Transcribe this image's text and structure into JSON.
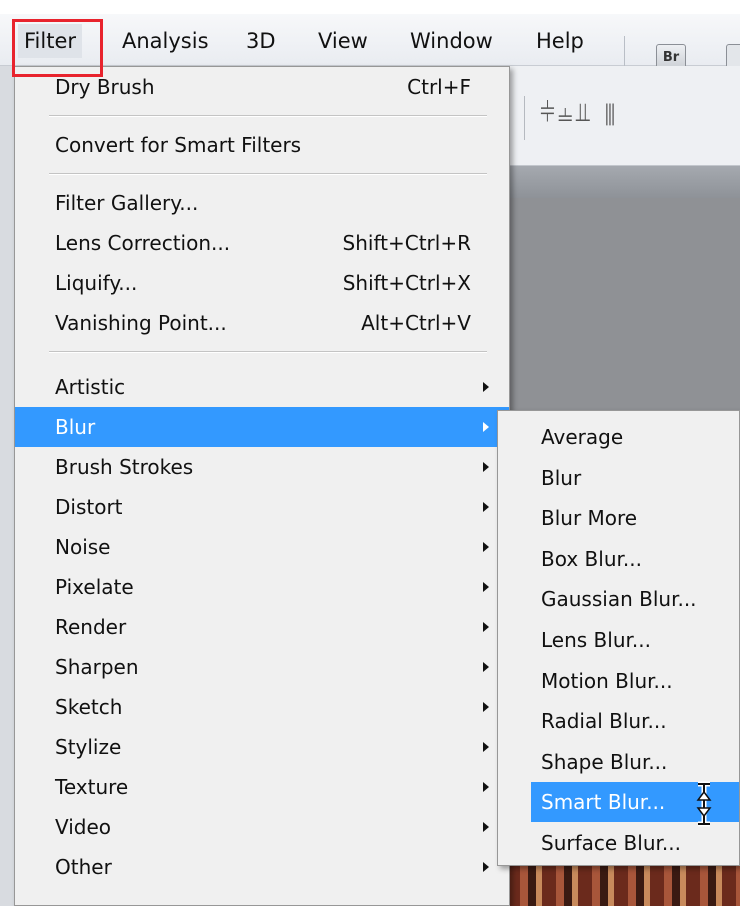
{
  "menubar": {
    "items": [
      "Filter",
      "Analysis",
      "3D",
      "View",
      "Window",
      "Help"
    ],
    "active": "Filter",
    "bridge_label": "Br"
  },
  "filter_menu": {
    "top_group": [
      {
        "label": "Dry Brush",
        "shortcut": "Ctrl+F"
      }
    ],
    "smart_group": [
      {
        "label": "Convert for Smart Filters"
      }
    ],
    "tools_group": [
      {
        "label": "Filter Gallery...",
        "shortcut": ""
      },
      {
        "label": "Lens Correction...",
        "shortcut": "Shift+Ctrl+R"
      },
      {
        "label": "Liquify...",
        "shortcut": "Shift+Ctrl+X"
      },
      {
        "label": "Vanishing Point...",
        "shortcut": "Alt+Ctrl+V"
      }
    ],
    "category_group": [
      "Artistic",
      "Blur",
      "Brush Strokes",
      "Distort",
      "Noise",
      "Pixelate",
      "Render",
      "Sharpen",
      "Sketch",
      "Stylize",
      "Texture",
      "Video",
      "Other"
    ],
    "selected_category": "Blur"
  },
  "blur_submenu": {
    "items": [
      "Average",
      "Blur",
      "Blur More",
      "Box Blur...",
      "Gaussian Blur...",
      "Lens Blur...",
      "Motion Blur...",
      "Radial Blur...",
      "Shape Blur...",
      "Smart Blur...",
      "Surface Blur..."
    ],
    "selected": "Smart Blur..."
  },
  "colors": {
    "highlight": "#3399ff",
    "menu_background": "#f0f0f0",
    "callout_border": "#e8232d"
  },
  "icons": {
    "submenu_arrow": "chevron-right-icon",
    "cursor": "text-cursor-icon",
    "align": "align-icons"
  }
}
